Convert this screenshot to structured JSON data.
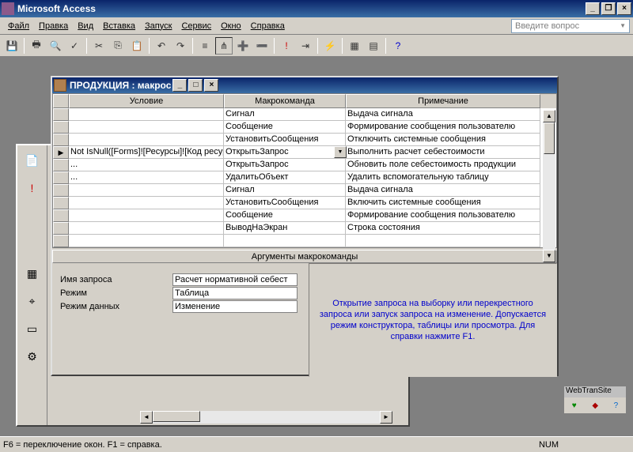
{
  "app": {
    "title": "Microsoft Access"
  },
  "menu": {
    "file": "Файл",
    "edit": "Правка",
    "view": "Вид",
    "insert": "Вставка",
    "run": "Запуск",
    "service": "Сервис",
    "window": "Окно",
    "help": "Справка"
  },
  "questionbox": {
    "placeholder": "Введите вопрос"
  },
  "macro": {
    "title": "ПРОДУКЦИЯ : макрос",
    "cols": {
      "cond": "Условие",
      "cmd": "Макрокоманда",
      "note": "Примечание"
    },
    "rows": [
      {
        "cond": "",
        "cmd": "Сигнал",
        "note": "Выдача сигнала"
      },
      {
        "cond": "",
        "cmd": "Сообщение",
        "note": "Формирование сообщения пользователю"
      },
      {
        "cond": "",
        "cmd": "УстановитьСообщения",
        "note": "Отключить системные сообщения"
      },
      {
        "cond": "Not IsNull([Forms]![Ресурсы]![Код ресурса])",
        "cmd": "ОткрытьЗапрос",
        "note": "Выполнить расчет себестоимости",
        "sel": true
      },
      {
        "cond": "...",
        "cmd": "ОткрытьЗапрос",
        "note": "Обновить поле себестоимость продукции"
      },
      {
        "cond": "...",
        "cmd": "УдалитьОбъект",
        "note": "Удалить вспомогательную таблицу"
      },
      {
        "cond": "",
        "cmd": "Сигнал",
        "note": "Выдача сигнала"
      },
      {
        "cond": "",
        "cmd": "УстановитьСообщения",
        "note": "Включить системные сообщения"
      },
      {
        "cond": "",
        "cmd": "Сообщение",
        "note": "Формирование сообщения пользователю"
      },
      {
        "cond": "",
        "cmd": "ВыводНаЭкран",
        "note": "Строка состояния"
      },
      {
        "cond": "",
        "cmd": "",
        "note": ""
      }
    ],
    "args_title": "Аргументы макрокоманды",
    "args": [
      {
        "label": "Имя запроса",
        "value": "Расчет нормативной себест"
      },
      {
        "label": "Режим",
        "value": "Таблица"
      },
      {
        "label": "Режим данных",
        "value": "Изменение"
      }
    ],
    "help": "Открытие запроса на выборку или перекрестного запроса или запуск запроса на изменение. Допускается режим конструктора, таблицы или просмотра. Для справки нажмите F1."
  },
  "webtran": {
    "title": "WebTranSite"
  },
  "status": {
    "text": "F6 = переключение окон.  F1 = справка.",
    "num": "NUM"
  }
}
